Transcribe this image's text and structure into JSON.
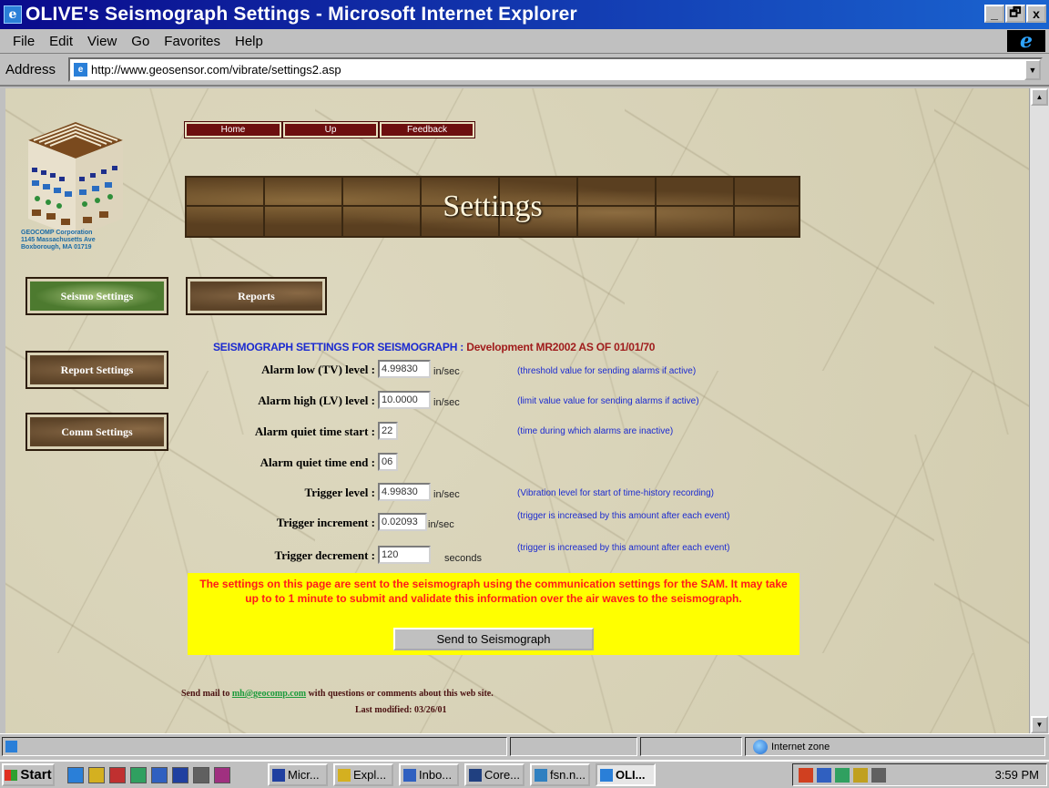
{
  "window": {
    "title": "OLIVE's  Seismograph Settings - Microsoft Internet Explorer",
    "buttons": {
      "minimize": "_",
      "restore": "🗗",
      "close": "x"
    }
  },
  "menubar": [
    "File",
    "Edit",
    "View",
    "Go",
    "Favorites",
    "Help"
  ],
  "address": {
    "label": "Address",
    "url": "http://www.geosensor.com/vibrate/settings2.asp"
  },
  "page": {
    "logo_caption": [
      "GEOCOMP Corporation",
      "1145 Massachusetts Ave",
      "Boxborough, MA 01719"
    ],
    "nav_buttons": [
      "Home",
      "Up",
      "Feedback"
    ],
    "banner_title": "Settings",
    "main_buttons": {
      "seismo": "Seismo Settings",
      "reports": "Reports",
      "report_settings": "Report Settings",
      "comm_settings": "Comm Settings"
    },
    "heading": {
      "prefix": "SEISMOGRAPH SETTINGS FOR SEISMOGRAPH : ",
      "suffix": "Development MR2002 AS OF 01/01/70"
    },
    "fields": [
      {
        "label": "Alarm low (TV) level :",
        "value": "4.99830",
        "unit": "in/sec",
        "help": "(threshold value for sending alarms if active)"
      },
      {
        "label": "Alarm high (LV) level :",
        "value": "10.0000",
        "unit": "in/sec",
        "help": "(limit value value for sending alarms if active)"
      },
      {
        "label": "Alarm quiet time start :",
        "value": "22",
        "unit": "",
        "help": "(time during which alarms are inactive)"
      },
      {
        "label": "Alarm quiet time end :",
        "value": "06",
        "unit": "",
        "help": ""
      },
      {
        "label": "Trigger level :",
        "value": "4.99830",
        "unit": "in/sec",
        "help": "(Vibration level for start of time-history recording)"
      },
      {
        "label": "Trigger increment :",
        "value": "0.02093",
        "unit": "in/sec",
        "help": "(trigger is increased by this amount after each event)"
      },
      {
        "label": "Trigger decrement :",
        "value": "120",
        "unit": "seconds",
        "help": "(trigger is increased by this amount after each event)"
      }
    ],
    "notice": "The settings on this page are sent to the seismograph  using the communication settings for the SAM. It may take up to to 1 minute to submit and validate this information over the air waves to the seismograph.",
    "send_button": "Send to Seismograph",
    "footer": {
      "prefix": "Send mail to ",
      "email": "mh@geocomp.com",
      "suffix": " with questions or comments about this web site.",
      "modified": "Last modified: 03/26/01"
    }
  },
  "statusbar": {
    "zone": "Internet zone"
  },
  "taskbar": {
    "start": "Start",
    "tasks": [
      {
        "label": "Micr...",
        "icon_color": "#2040a0",
        "active": false
      },
      {
        "label": "Expl...",
        "icon_color": "#d4b020",
        "active": false
      },
      {
        "label": "Inbo...",
        "icon_color": "#3060c0",
        "active": false
      },
      {
        "label": "Core...",
        "icon_color": "#204080",
        "active": false
      },
      {
        "label": "fsn.n...",
        "icon_color": "#3080c0",
        "active": false
      },
      {
        "label": "OLI...",
        "icon_color": "#2a7fd8",
        "active": true
      }
    ],
    "clock": "3:59 PM"
  },
  "colors": {
    "title_bar": "#0a0a8c",
    "heading_blue": "#1b2ad0",
    "heading_red": "#a01c1c",
    "notice_bg": "#ffff00",
    "notice_text": "#ff1a1a"
  }
}
